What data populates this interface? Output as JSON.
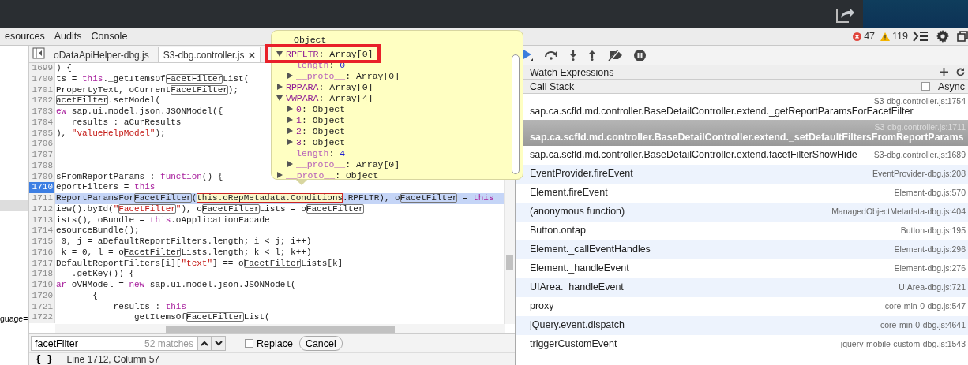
{
  "devtools_tabs": [
    {
      "label": "esources",
      "selected": false
    },
    {
      "label": "Audits",
      "selected": false
    },
    {
      "label": "Console",
      "selected": false
    }
  ],
  "counters": {
    "errors": "47",
    "warnings": "119"
  },
  "sidebar": {
    "text": "guage="
  },
  "file_tabs": [
    {
      "label": "oDataApiHelper-dbg.js",
      "selected": false,
      "closable": false
    },
    {
      "label": "S3-dbg.controller.js",
      "selected": true,
      "closable": true
    }
  ],
  "editor": {
    "lines": [
      {
        "number": "1699",
        "highlighted": false,
        "breakpoint": false,
        "segments": [
          {
            "kind": "plain",
            "text": ") {"
          }
        ]
      },
      {
        "number": "1700",
        "highlighted": false,
        "breakpoint": false,
        "segments": [
          {
            "kind": "plain",
            "text": "ts = "
          },
          {
            "kind": "keyword",
            "text": "this"
          },
          {
            "kind": "plain",
            "text": "._getItemsOf"
          },
          {
            "kind": "match",
            "text": "FacetFilter"
          },
          {
            "kind": "plain",
            "text": "List("
          }
        ]
      },
      {
        "number": "1701",
        "highlighted": false,
        "breakpoint": false,
        "segments": [
          {
            "kind": "plain",
            "text": "PropertyText, oCurrent"
          },
          {
            "kind": "match",
            "text": "FacetFilter"
          },
          {
            "kind": "plain",
            "text": ");"
          }
        ]
      },
      {
        "number": "1702",
        "highlighted": false,
        "breakpoint": false,
        "segments": [
          {
            "kind": "match",
            "text": "acetFilter"
          },
          {
            "kind": "plain",
            "text": ".setModel("
          }
        ]
      },
      {
        "number": "1703",
        "highlighted": false,
        "breakpoint": false,
        "segments": [
          {
            "kind": "keyword",
            "text": "ew"
          },
          {
            "kind": "plain",
            "text": " sap.ui.model.json.JSONModel({"
          }
        ]
      },
      {
        "number": "1704",
        "highlighted": false,
        "breakpoint": false,
        "segments": [
          {
            "kind": "plain",
            "text": "   results : aCurResults"
          }
        ]
      },
      {
        "number": "1705",
        "highlighted": false,
        "breakpoint": false,
        "segments": [
          {
            "kind": "plain",
            "text": "), "
          },
          {
            "kind": "string",
            "text": "\"valueHelpModel\""
          },
          {
            "kind": "plain",
            "text": ");"
          }
        ]
      },
      {
        "number": "1706",
        "highlighted": false,
        "breakpoint": false
      },
      {
        "number": "1707",
        "highlighted": false,
        "breakpoint": false
      },
      {
        "number": "1708",
        "highlighted": false,
        "breakpoint": false
      },
      {
        "number": "1709",
        "highlighted": false,
        "breakpoint": false,
        "segments": [
          {
            "kind": "plain",
            "text": "sFromReportParams : "
          },
          {
            "kind": "keyword",
            "text": "function"
          },
          {
            "kind": "plain",
            "text": "() {"
          }
        ]
      },
      {
        "number": "1710",
        "highlighted": false,
        "breakpoint": true,
        "segments": [
          {
            "kind": "plain",
            "text": "eportFilters = "
          },
          {
            "kind": "keyword",
            "text": "this"
          }
        ]
      },
      {
        "number": "1711",
        "highlighted": true,
        "breakpoint": false,
        "segments": [
          {
            "kind": "plain",
            "text": "ReportParamsFor"
          },
          {
            "kind": "match",
            "text": "FacetFilter"
          },
          {
            "kind": "plain",
            "text": "("
          },
          {
            "kind": "hover",
            "text": "this.oRepMetadata.Conditions"
          },
          {
            "kind": "plain",
            "text": ".RPFLTR), o"
          },
          {
            "kind": "match",
            "text": "FacetFilter"
          },
          {
            "kind": "plain",
            "text": " = "
          },
          {
            "kind": "keyword",
            "text": "this"
          }
        ]
      },
      {
        "number": "1712",
        "highlighted": false,
        "breakpoint": false,
        "segments": [
          {
            "kind": "plain",
            "text": "iew().byId("
          },
          {
            "kind": "string",
            "text": "\""
          },
          {
            "kind": "string_match",
            "text": "FacetFilter"
          },
          {
            "kind": "string",
            "text": "\""
          },
          {
            "kind": "plain",
            "text": "), o"
          },
          {
            "kind": "match",
            "text": "FacetFilter"
          },
          {
            "kind": "plain",
            "text": "Lists = o"
          },
          {
            "kind": "match",
            "text": "FacetFilter"
          }
        ]
      },
      {
        "number": "1713",
        "highlighted": false,
        "breakpoint": false,
        "segments": [
          {
            "kind": "plain",
            "text": "ists(), oBundle = "
          },
          {
            "kind": "keyword",
            "text": "this"
          },
          {
            "kind": "plain",
            "text": ".oApplicationFacade"
          }
        ]
      },
      {
        "number": "1714",
        "highlighted": false,
        "breakpoint": false,
        "segments": [
          {
            "kind": "plain",
            "text": "esourceBundle();"
          }
        ]
      },
      {
        "number": "1715",
        "highlighted": false,
        "breakpoint": false,
        "segments": [
          {
            "kind": "plain",
            "text": " 0, j = aDefaultReportFilters.length; i < j; i++)"
          }
        ]
      },
      {
        "number": "1716",
        "highlighted": false,
        "breakpoint": false,
        "segments": [
          {
            "kind": "plain",
            "text": " k = 0, l = o"
          },
          {
            "kind": "match",
            "text": "FacetFilter"
          },
          {
            "kind": "plain",
            "text": "Lists.length; k < l; k++)"
          }
        ]
      },
      {
        "number": "1717",
        "highlighted": false,
        "breakpoint": false,
        "segments": [
          {
            "kind": "plain",
            "text": "DefaultReportFilters[i]["
          },
          {
            "kind": "string",
            "text": "\"text\""
          },
          {
            "kind": "plain",
            "text": "] == o"
          },
          {
            "kind": "match",
            "text": "FacetFilter"
          },
          {
            "kind": "plain",
            "text": "Lists[k]"
          }
        ]
      },
      {
        "number": "1718",
        "highlighted": false,
        "breakpoint": false,
        "segments": [
          {
            "kind": "plain",
            "text": "   .getKey()) {"
          }
        ]
      },
      {
        "number": "1719",
        "highlighted": false,
        "breakpoint": false,
        "segments": [
          {
            "kind": "keyword",
            "text": "ar"
          },
          {
            "kind": "plain",
            "text": " oVHModel = "
          },
          {
            "kind": "keyword",
            "text": "new"
          },
          {
            "kind": "plain",
            "text": " sap.ui.model.json.JSONModel("
          }
        ]
      },
      {
        "number": "1720",
        "highlighted": false,
        "breakpoint": false,
        "segments": [
          {
            "kind": "plain",
            "text": "       {"
          }
        ]
      },
      {
        "number": "1721",
        "highlighted": false,
        "breakpoint": false,
        "segments": [
          {
            "kind": "plain",
            "text": "           results : "
          },
          {
            "kind": "keyword",
            "text": "this"
          }
        ]
      },
      {
        "number": "1722",
        "highlighted": false,
        "breakpoint": false,
        "segments": [
          {
            "kind": "plain",
            "text": "               getItemsOf"
          },
          {
            "kind": "match",
            "text": "FacetFilter"
          },
          {
            "kind": "plain",
            "text": "List("
          }
        ]
      }
    ]
  },
  "tooltip": {
    "title": "Object",
    "items": [
      {
        "name": "RPFLTR",
        "separator": ":",
        "value": "Array[0]",
        "kind": "property",
        "numeric": false,
        "expandable": true,
        "expanded": true,
        "outlined": true,
        "children": [
          {
            "name": "length",
            "separator": ":",
            "value": "0",
            "kind": "internal",
            "numeric": true,
            "expandable": false,
            "expanded": false,
            "outlined": false
          },
          {
            "name": "__proto__",
            "separator": ":",
            "value": "Array[0]",
            "kind": "internal",
            "numeric": false,
            "expandable": true,
            "expanded": false,
            "outlined": false
          }
        ]
      },
      {
        "name": "RPPARA",
        "separator": ":",
        "value": "Array[0]",
        "kind": "property",
        "numeric": false,
        "expandable": true,
        "expanded": false,
        "outlined": false
      },
      {
        "name": "VWPARA",
        "separator": ":",
        "value": "Array[4]",
        "kind": "property",
        "numeric": false,
        "expandable": true,
        "expanded": true,
        "outlined": false,
        "children": [
          {
            "name": "0",
            "separator": ":",
            "value": "Object",
            "kind": "property",
            "numeric": false,
            "expandable": true,
            "expanded": false,
            "outlined": false
          },
          {
            "name": "1",
            "separator": ":",
            "value": "Object",
            "kind": "property",
            "numeric": false,
            "expandable": true,
            "expanded": false,
            "outlined": false
          },
          {
            "name": "2",
            "separator": ":",
            "value": "Object",
            "kind": "property",
            "numeric": false,
            "expandable": true,
            "expanded": false,
            "outlined": false
          },
          {
            "name": "3",
            "separator": ":",
            "value": "Object",
            "kind": "property",
            "numeric": false,
            "expandable": true,
            "expanded": false,
            "outlined": false
          },
          {
            "name": "length",
            "separator": ":",
            "value": "4",
            "kind": "internal",
            "numeric": true,
            "expandable": false,
            "expanded": false,
            "outlined": false
          },
          {
            "name": "__proto__",
            "separator": ":",
            "value": "Array[0]",
            "kind": "internal",
            "numeric": false,
            "expandable": true,
            "expanded": false,
            "outlined": false
          }
        ]
      },
      {
        "name": "__proto__",
        "separator": ":",
        "value": "Object",
        "kind": "internal",
        "numeric": false,
        "expandable": true,
        "expanded": false,
        "outlined": false
      }
    ]
  },
  "search": {
    "value": "facetFilter",
    "matches": "52 matches",
    "replace_label": "Replace",
    "replace_checked": false,
    "cancel_label": "Cancel"
  },
  "status_bar": {
    "format_label": "{ }",
    "position": "Line 1712, Column 57"
  },
  "debugger": {
    "watch_title": "Watch Expressions",
    "call_stack_title": "Call Stack",
    "async_label": "Async",
    "async_checked": false,
    "frames": [
      {
        "function": "sap.ca.scfld.md.controller.BaseDetailController.extend._getReportParamsForFacetFilter",
        "location": "S3-dbg.controller.js:1754",
        "selected": false
      },
      {
        "function": "sap.ca.scfld.md.controller.BaseDetailController.extend._setDefaultFiltersFromReportParams",
        "location": "S3-dbg.controller.js:1711",
        "selected": true
      },
      {
        "function": "sap.ca.scfld.md.controller.BaseDetailController.extend.facetFilterShowHide",
        "location": "S3-dbg.controller.js:1689",
        "selected": false
      },
      {
        "function": "EventProvider.fireEvent",
        "location": "EventProvider-dbg.js:208",
        "selected": false
      },
      {
        "function": "Element.fireEvent",
        "location": "Element-dbg.js:570",
        "selected": false
      },
      {
        "function": "(anonymous function)",
        "location": "ManagedObjectMetadata-dbg.js:404",
        "selected": false
      },
      {
        "function": "Button.ontap",
        "location": "Button-dbg.js:195",
        "selected": false
      },
      {
        "function": "Element._callEventHandles",
        "location": "Element-dbg.js:296",
        "selected": false
      },
      {
        "function": "Element._handleEvent",
        "location": "Element-dbg.js:276",
        "selected": false
      },
      {
        "function": "UIArea._handleEvent",
        "location": "UIArea-dbg.js:721",
        "selected": false
      },
      {
        "function": "proxy",
        "location": "core-min-0-dbg.js:547",
        "selected": false
      },
      {
        "function": "jQuery.event.dispatch",
        "location": "core-min-0-dbg.js:4641",
        "selected": false
      },
      {
        "function": "triggerCustomEvent",
        "location": "jquery-mobile-custom-dbg.js:1543",
        "selected": false
      }
    ]
  }
}
